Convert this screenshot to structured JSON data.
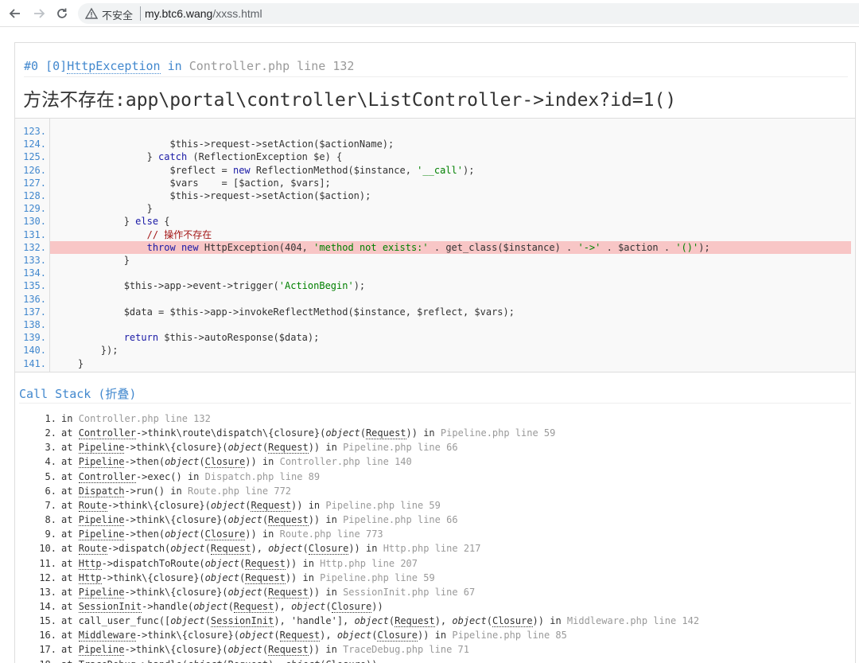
{
  "browser": {
    "security_label": "不安全",
    "url_host": "my.btc6.wang",
    "url_path": "/xxss.html",
    "icons": [
      "back-arrow-icon",
      "forward-arrow-icon",
      "reload-icon",
      "warning-icon"
    ]
  },
  "exception": {
    "frame_prefix": "#0 [0]",
    "class_name": "HttpException",
    "in_word": " in ",
    "file": "Controller.php line 132",
    "message": "方法不存在:app\\portal\\controller\\ListController->index?id=1()"
  },
  "source": {
    "lines": [
      {
        "no": "123.",
        "code": ""
      },
      {
        "no": "124.",
        "code": "                    $this->request->setAction($actionName);"
      },
      {
        "no": "125.",
        "code": "                } catch (ReflectionException $e) {"
      },
      {
        "no": "126.",
        "code": "                    $reflect = new ReflectionMethod($instance, '__call');"
      },
      {
        "no": "127.",
        "code": "                    $vars    = [$action, $vars];"
      },
      {
        "no": "128.",
        "code": "                    $this->request->setAction($action);"
      },
      {
        "no": "129.",
        "code": "                }"
      },
      {
        "no": "130.",
        "code": "            } else {"
      },
      {
        "no": "131.",
        "code": "                // 操作不存在"
      },
      {
        "no": "132.",
        "code": "                throw new HttpException(404, 'method not exists:' . get_class($instance) . '->' . $action . '()');"
      },
      {
        "no": "133.",
        "code": "            }"
      },
      {
        "no": "134.",
        "code": ""
      },
      {
        "no": "135.",
        "code": "            $this->app->event->trigger('ActionBegin');"
      },
      {
        "no": "136.",
        "code": ""
      },
      {
        "no": "137.",
        "code": "            $data = $this->app->invokeReflectMethod($instance, $reflect, $vars);"
      },
      {
        "no": "138.",
        "code": ""
      },
      {
        "no": "139.",
        "code": "            return $this->autoResponse($data);"
      },
      {
        "no": "140.",
        "code": "        });"
      },
      {
        "no": "141.",
        "code": "    }"
      }
    ],
    "highlight_line": "132."
  },
  "call_stack": {
    "title": "Call Stack (折叠)",
    "items": [
      {
        "no": "1.",
        "text": "in ",
        "loc": "Controller.php line 132"
      },
      {
        "no": "2.",
        "text": "at Controller->think\\route\\dispatch\\{closure}(object(Request)) in ",
        "loc": "Pipeline.php line 59"
      },
      {
        "no": "3.",
        "text": "at Pipeline->think\\{closure}(object(Request)) in ",
        "loc": "Pipeline.php line 66"
      },
      {
        "no": "4.",
        "text": "at Pipeline->then(object(Closure)) in ",
        "loc": "Controller.php line 140"
      },
      {
        "no": "5.",
        "text": "at Controller->exec() in ",
        "loc": "Dispatch.php line 89"
      },
      {
        "no": "6.",
        "text": "at Dispatch->run() in ",
        "loc": "Route.php line 772"
      },
      {
        "no": "7.",
        "text": "at Route->think\\{closure}(object(Request)) in ",
        "loc": "Pipeline.php line 59"
      },
      {
        "no": "8.",
        "text": "at Pipeline->think\\{closure}(object(Request)) in ",
        "loc": "Pipeline.php line 66"
      },
      {
        "no": "9.",
        "text": "at Pipeline->then(object(Closure)) in ",
        "loc": "Route.php line 773"
      },
      {
        "no": "10.",
        "text": "at Route->dispatch(object(Request), object(Closure)) in ",
        "loc": "Http.php line 217"
      },
      {
        "no": "11.",
        "text": "at Http->dispatchToRoute(object(Request)) in ",
        "loc": "Http.php line 207"
      },
      {
        "no": "12.",
        "text": "at Http->think\\{closure}(object(Request)) in ",
        "loc": "Pipeline.php line 59"
      },
      {
        "no": "13.",
        "text": "at Pipeline->think\\{closure}(object(Request)) in ",
        "loc": "SessionInit.php line 67"
      },
      {
        "no": "14.",
        "text": "at SessionInit->handle(object(Request), object(Closure))",
        "loc": ""
      },
      {
        "no": "15.",
        "text": "at call_user_func([object(SessionInit), 'handle'], object(Request), object(Closure)) in ",
        "loc": "Middleware.php line 142"
      },
      {
        "no": "16.",
        "text": "at Middleware->think\\{closure}(object(Request), object(Closure)) in ",
        "loc": "Pipeline.php line 85"
      },
      {
        "no": "17.",
        "text": "at Pipeline->think\\{closure}(object(Request)) in ",
        "loc": "TraceDebug.php line 71"
      },
      {
        "no": "18.",
        "text": "at TraceDebug->handle(object(Request), object(Closure))",
        "loc": ""
      }
    ]
  }
}
